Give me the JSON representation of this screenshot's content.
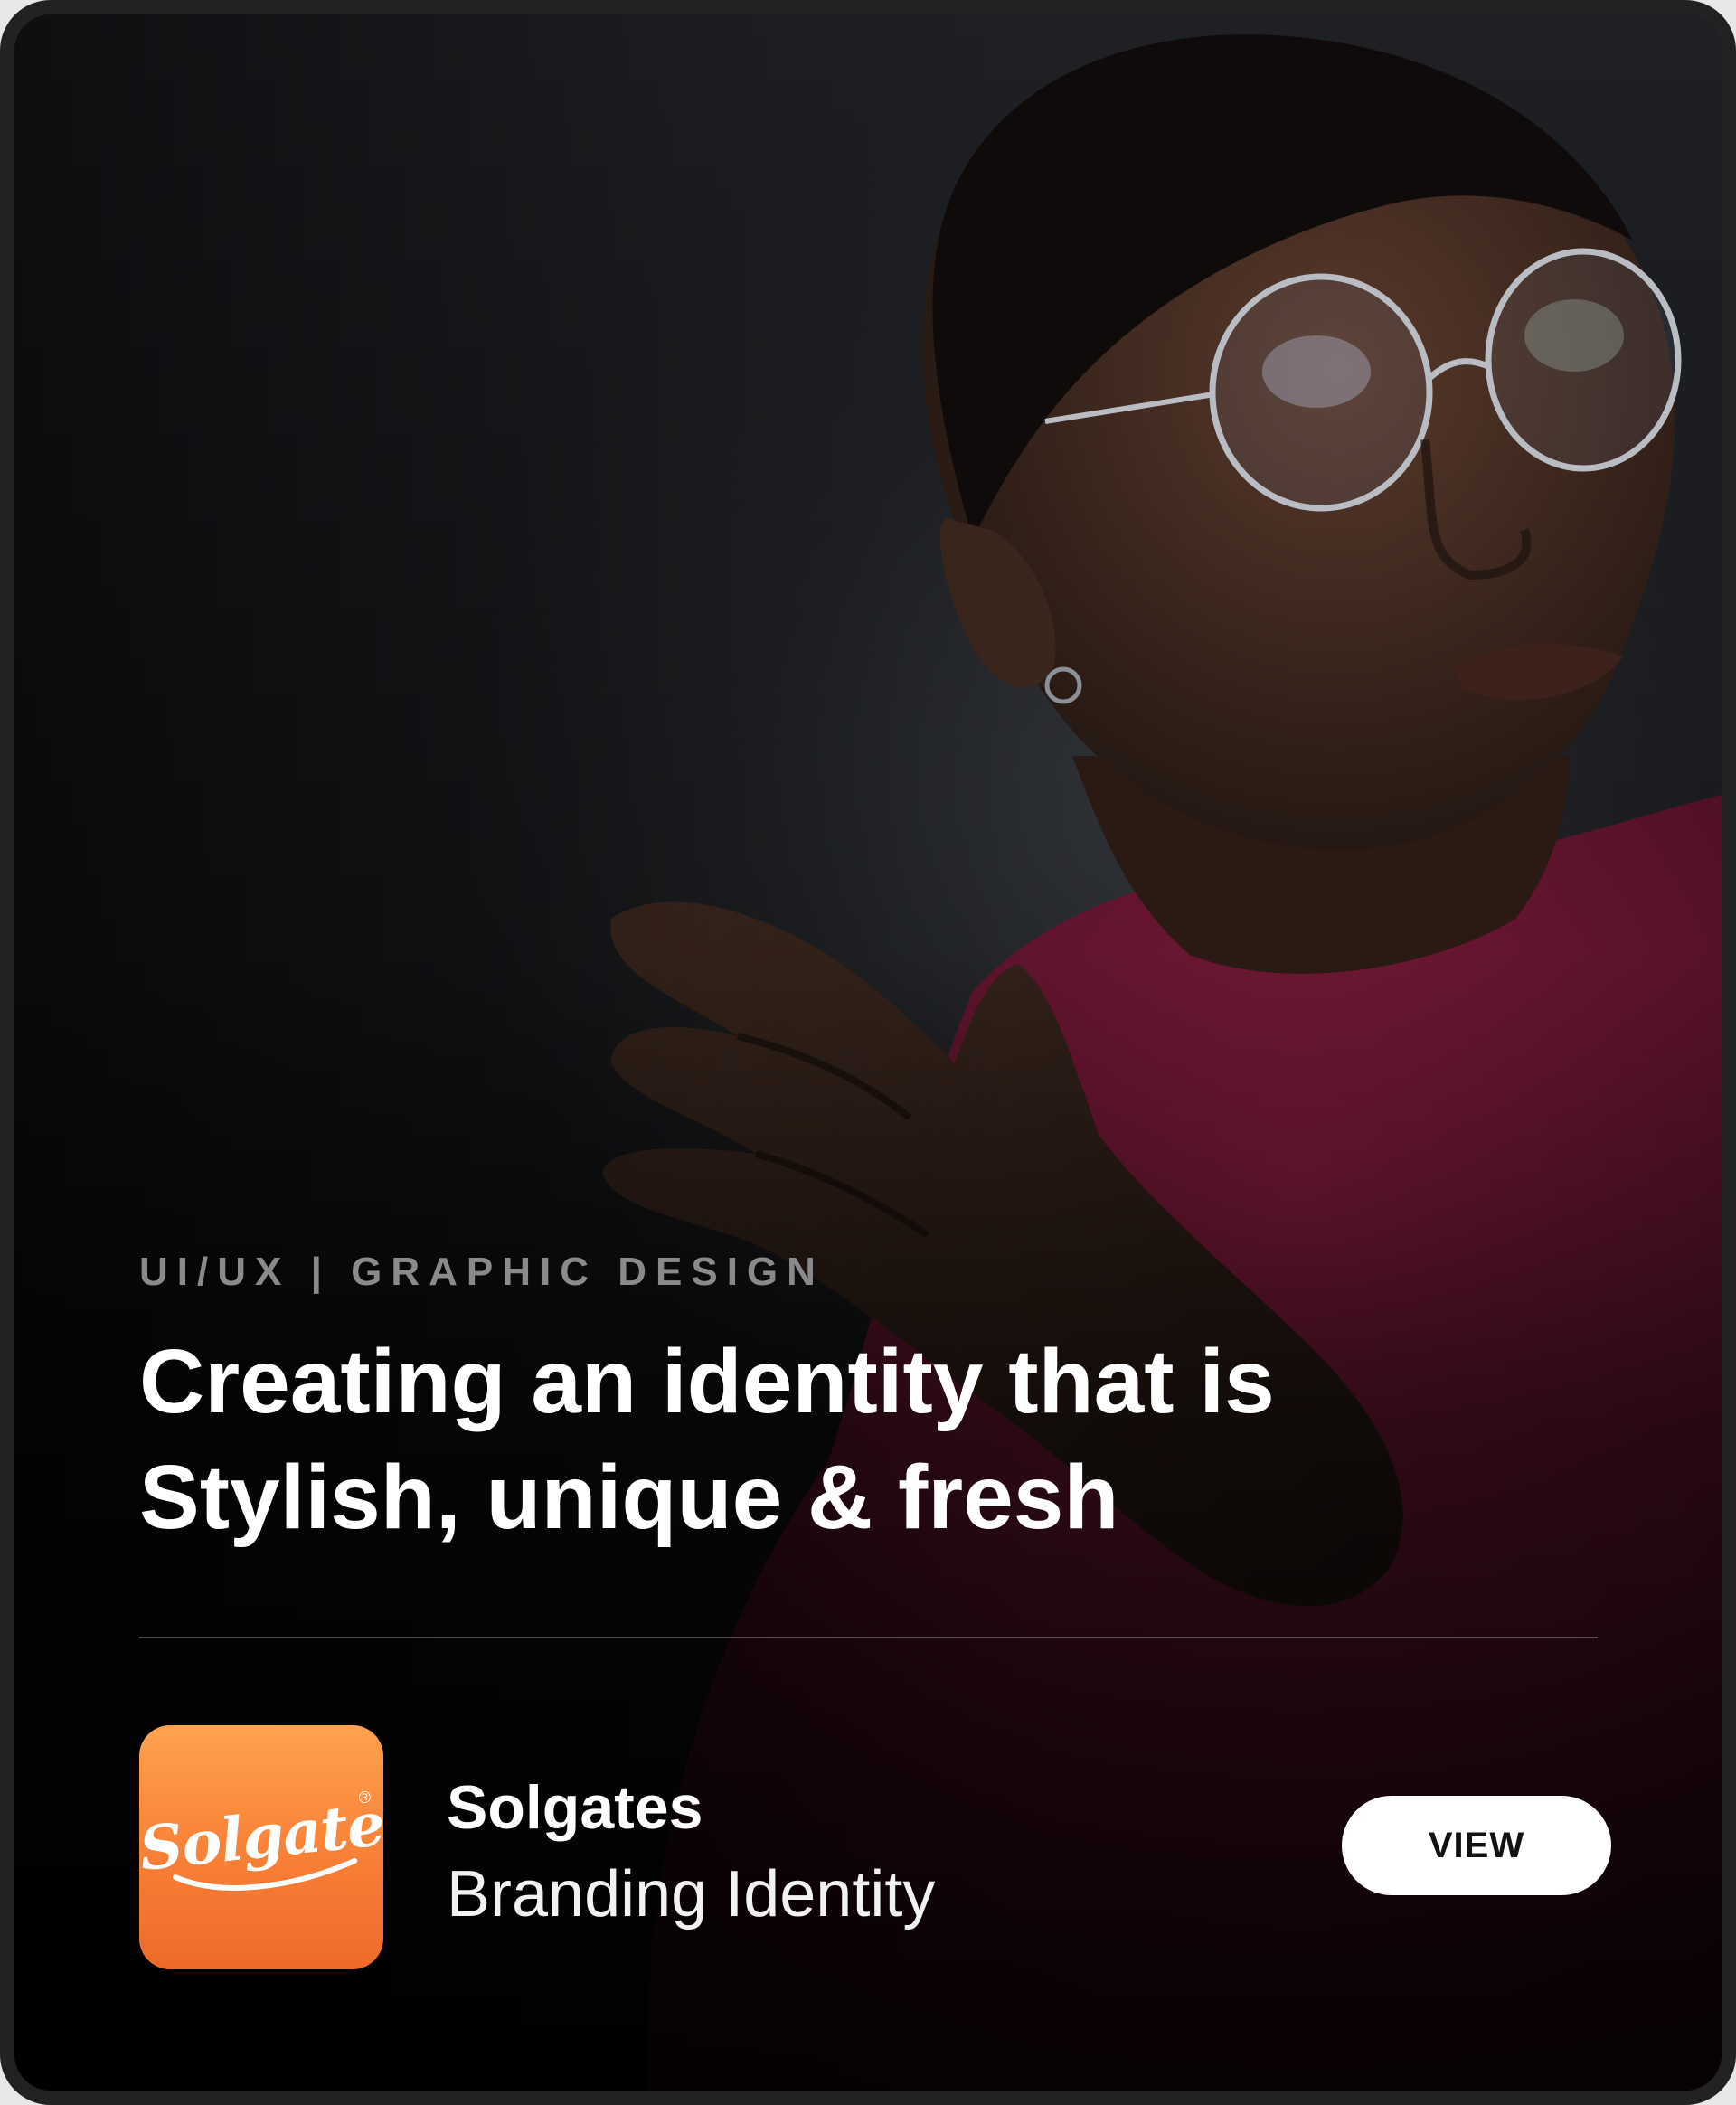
{
  "card": {
    "category": "UI/UX | GRAPHIC DESIGN",
    "headline": "Creating an identity that is Stylish, unique & fresh",
    "client": {
      "logo_text": "Solgates",
      "logo_mark": "®",
      "name": "Solgates",
      "service": "Branding Identity"
    },
    "view_button_label": "VIEW"
  },
  "colors": {
    "logo_tile": "#f77c34",
    "button_bg": "#ffffff",
    "sweater": "#6a1530",
    "category_text": "#8a8a8d"
  }
}
